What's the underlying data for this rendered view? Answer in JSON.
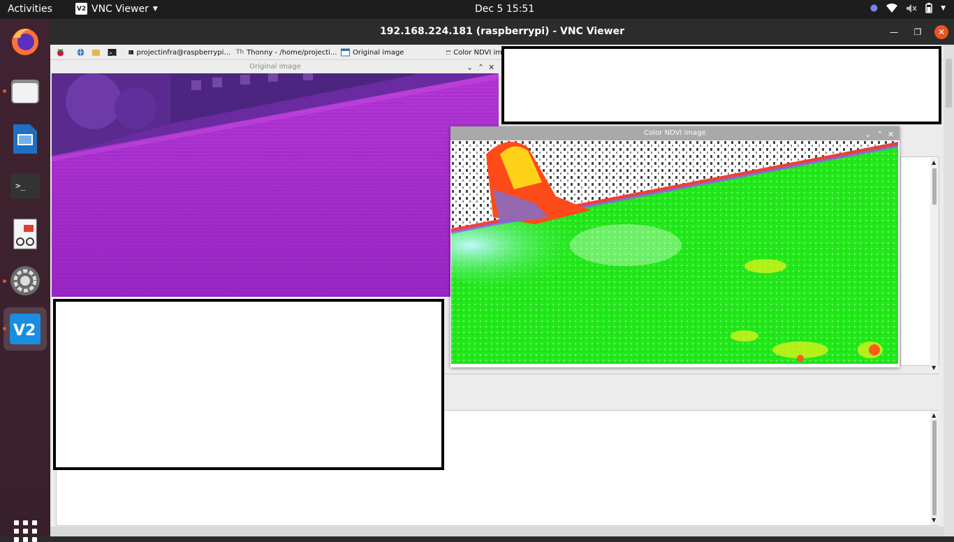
{
  "topbar": {
    "activities": "Activities",
    "app_name": "VNC Viewer",
    "clock": "Dec 5  15:51"
  },
  "dock": {
    "items": [
      "firefox",
      "files",
      "libreoffice-impress",
      "terminal",
      "document-viewer",
      "settings",
      "vnc-viewer",
      "show-applications"
    ]
  },
  "vnc": {
    "title": "192.168.224.181 (raspberrypi) - VNC Viewer",
    "pi_taskbar": {
      "tasks": [
        "projectinfra@raspberrypi...",
        "Thonny  -  /home/projecti...",
        "Original image",
        "Color NDVI im"
      ]
    },
    "original_window": {
      "title": "Original image"
    },
    "ndvi_window": {
      "title": "Color NDVI image"
    }
  },
  "colors": {
    "ubuntu_orange": "#e95420",
    "ndvi_green": "#22e81a",
    "infrared_purple": "#a528d6"
  }
}
